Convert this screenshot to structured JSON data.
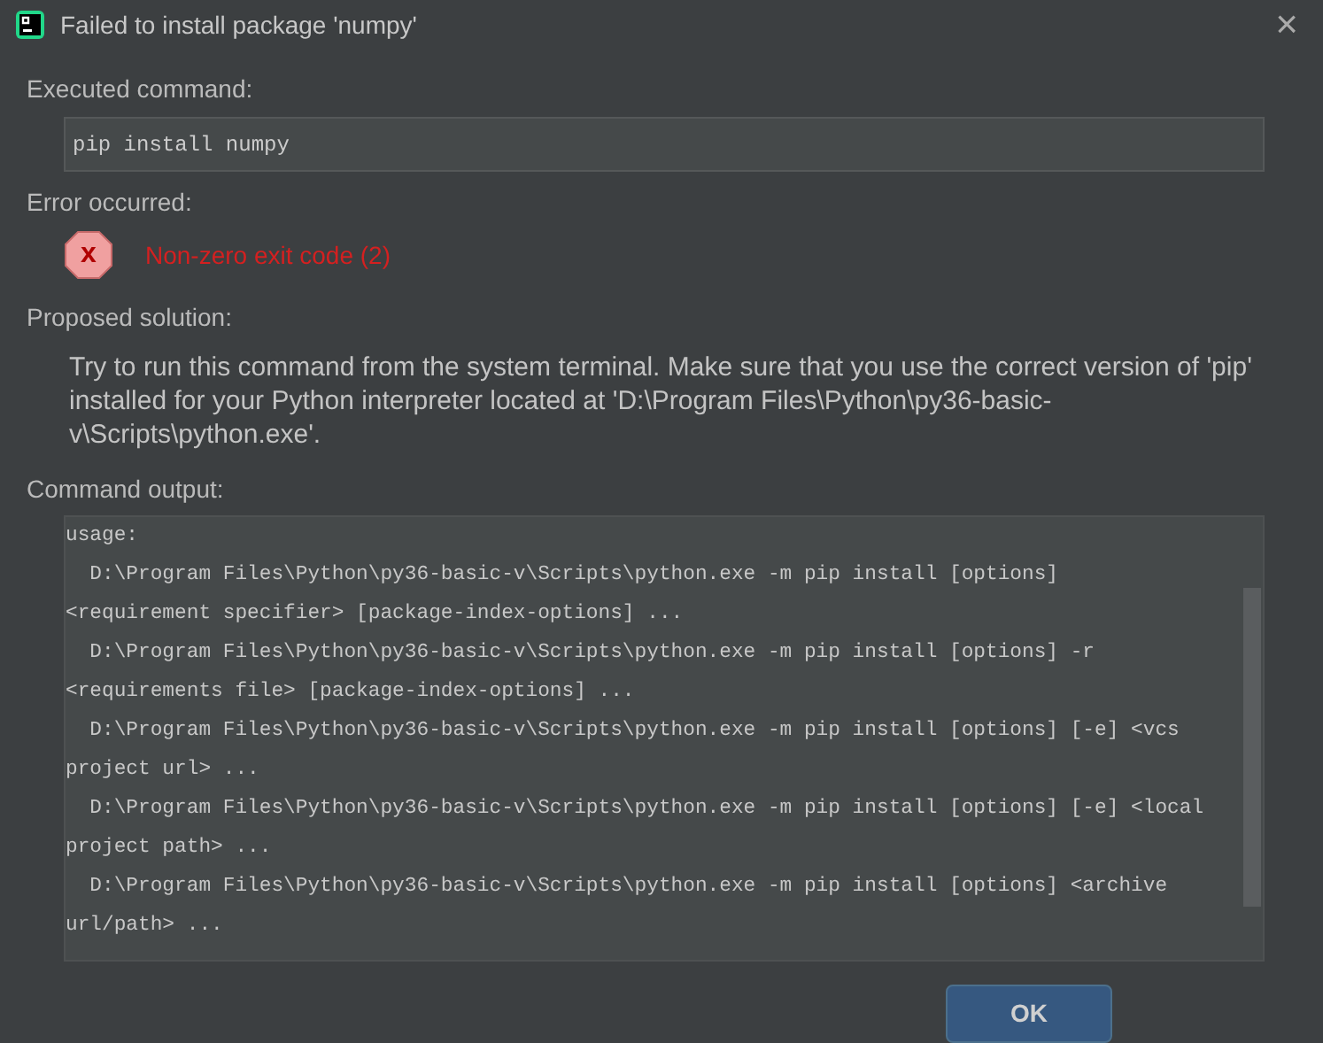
{
  "window": {
    "title": "Failed to install package 'numpy'",
    "close": "×"
  },
  "executed": {
    "label": "Executed command:",
    "command": "pip install numpy"
  },
  "error": {
    "label": "Error occurred:",
    "icon_text": "x",
    "message": "Non-zero exit code (2)"
  },
  "solution": {
    "label": "Proposed solution:",
    "text": "Try to run this command from the system terminal. Make sure that you use the correct version of 'pip' installed for your Python interpreter located at 'D:\\Program Files\\Python\\py36-basic-v\\Scripts\\python.exe'."
  },
  "output": {
    "label": "Command output:",
    "lines": [
      "usage:",
      "  D:\\Program Files\\Python\\py36-basic-v\\Scripts\\python.exe -m pip install [options]",
      "<requirement specifier> [package-index-options] ...",
      "  D:\\Program Files\\Python\\py36-basic-v\\Scripts\\python.exe -m pip install [options] -r",
      "<requirements file> [package-index-options] ...",
      "  D:\\Program Files\\Python\\py36-basic-v\\Scripts\\python.exe -m pip install [options] [-e] <vcs",
      "project url> ...",
      "  D:\\Program Files\\Python\\py36-basic-v\\Scripts\\python.exe -m pip install [options] [-e] <local",
      "project path> ...",
      "  D:\\Program Files\\Python\\py36-basic-v\\Scripts\\python.exe -m pip install [options] <archive",
      "url/path> ..."
    ]
  },
  "buttons": [
    {
      "label": "OK",
      "default": true
    }
  ]
}
